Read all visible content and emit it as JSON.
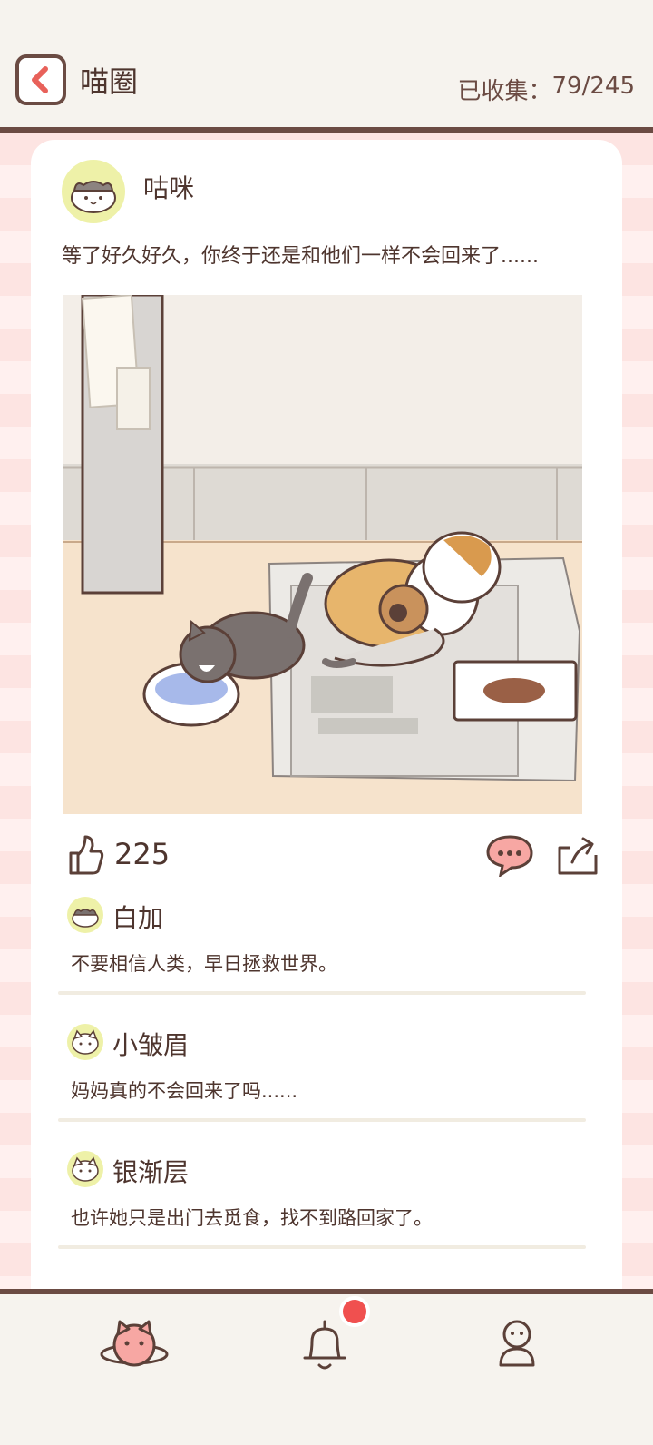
{
  "header": {
    "title": "喵圈",
    "collected_label": "已收集：",
    "collected_value": "79/245"
  },
  "post": {
    "author": "咕咪",
    "text": "等了好久好久，你终于还是和他们一样不会回来了......",
    "likes": "225"
  },
  "comments": [
    {
      "name": "白加",
      "text": "不要相信人类，早日拯救世界。"
    },
    {
      "name": "小皱眉",
      "text": "妈妈真的不会回来了吗......"
    },
    {
      "name": "银渐层",
      "text": "也许她只是出门去觅食，找不到路回家了。"
    }
  ],
  "colors": {
    "accent": "#e8615a",
    "brown": "#6b4b43",
    "stripe_pink": "#fde4e2",
    "badge": "#f0504f"
  },
  "icons": {
    "back": "chevron-left-icon",
    "like": "thumbs-up-icon",
    "comment": "speech-bubble-icon",
    "share": "share-icon",
    "nav_home": "cat-planet-icon",
    "nav_notifications": "bell-icon",
    "nav_profile": "person-icon"
  }
}
